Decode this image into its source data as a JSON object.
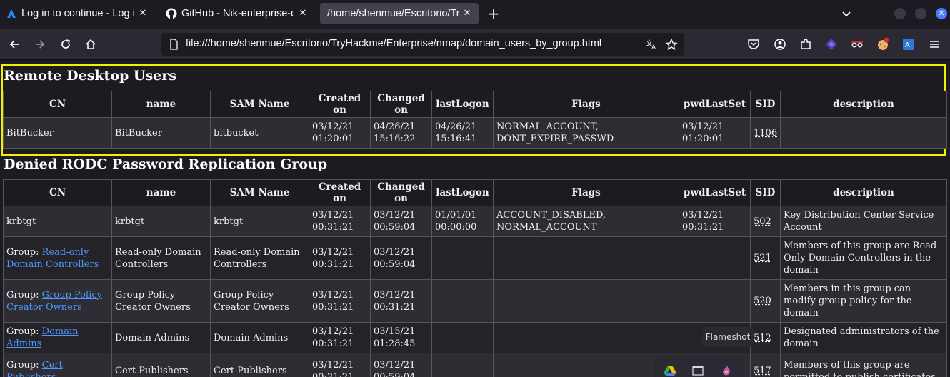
{
  "browser": {
    "tabs": [
      {
        "title": "Log in to continue - Log in",
        "icon": "atlassian-icon"
      },
      {
        "title": "GitHub - Nik-enterprise-dev",
        "icon": "github-icon"
      },
      {
        "title": "/home/shenmue/Escritorio/TryHackme",
        "icon": "none"
      }
    ],
    "url": "file:///home/shenmue/Escritorio/TryHackme/Enterprise/nmap/domain_users_by_group.html",
    "colors": {
      "accent": "#4a7cff",
      "highlight": "#f0f000",
      "link": "#4e97ff"
    }
  },
  "columns": [
    "CN",
    "name",
    "SAM Name",
    "Created on",
    "Changed on",
    "lastLogon",
    "Flags",
    "pwdLastSet",
    "SID",
    "description"
  ],
  "groups": [
    {
      "title": "Remote Desktop Users",
      "rows": [
        {
          "cn_prefix": "",
          "cn": "BitBucker",
          "cn_link": "",
          "name": "BitBucker",
          "sam": "bitbucket",
          "created": "03/12/21 01:20:01",
          "changed": "04/26/21 15:16:22",
          "lastlogon": "04/26/21 15:16:41",
          "flags": "NORMAL_ACCOUNT, DONT_EXPIRE_PASSWD",
          "pwdlastset": "03/12/21 01:20:01",
          "sid": "1106",
          "description": ""
        }
      ]
    },
    {
      "title": "Denied RODC Password Replication Group",
      "rows": [
        {
          "cn_prefix": "",
          "cn": "krbtgt",
          "cn_link": "",
          "name": "krbtgt",
          "sam": "krbtgt",
          "created": "03/12/21 00:31:21",
          "changed": "03/12/21 00:59:04",
          "lastlogon": "01/01/01 00:00:00",
          "flags": "ACCOUNT_DISABLED, NORMAL_ACCOUNT",
          "pwdlastset": "03/12/21 00:31:21",
          "sid": "502",
          "description": "Key Distribution Center Service Account"
        },
        {
          "cn_prefix": "Group: ",
          "cn": "",
          "cn_link": "Read-only Domain Controllers",
          "name": "Read-only Domain Controllers",
          "sam": "Read-only Domain Controllers",
          "created": "03/12/21 00:31:21",
          "changed": "03/12/21 00:59:04",
          "lastlogon": "",
          "flags": "",
          "pwdlastset": "",
          "sid": "521",
          "description": "Members of this group are Read-Only Domain Controllers in the domain"
        },
        {
          "cn_prefix": "Group: ",
          "cn": "",
          "cn_link": "Group Policy Creator Owners",
          "name": "Group Policy Creator Owners",
          "sam": "Group Policy Creator Owners",
          "created": "03/12/21 00:31:21",
          "changed": "03/12/21 00:31:21",
          "lastlogon": "",
          "flags": "",
          "pwdlastset": "",
          "sid": "520",
          "description": "Members in this group can modify group policy for the domain"
        },
        {
          "cn_prefix": "Group: ",
          "cn": "",
          "cn_link": "Domain Admins",
          "name": "Domain Admins",
          "sam": "Domain Admins",
          "created": "03/12/21 00:31:21",
          "changed": "03/15/21 01:28:45",
          "lastlogon": "",
          "flags": "",
          "pwdlastset": "",
          "sid": "512",
          "description": "Designated administrators of the domain"
        },
        {
          "cn_prefix": "Group: ",
          "cn": "",
          "cn_link": "Cert Publishers",
          "name": "Cert Publishers",
          "sam": "Cert Publishers",
          "created": "03/12/21 00:31:21",
          "changed": "03/12/21 00:59:04",
          "lastlogon": "",
          "flags": "",
          "pwdlastset": "",
          "sid": "517",
          "description": "Members of this group are permitted to publish certificates"
        }
      ]
    }
  ],
  "tooltip": "Flameshot"
}
